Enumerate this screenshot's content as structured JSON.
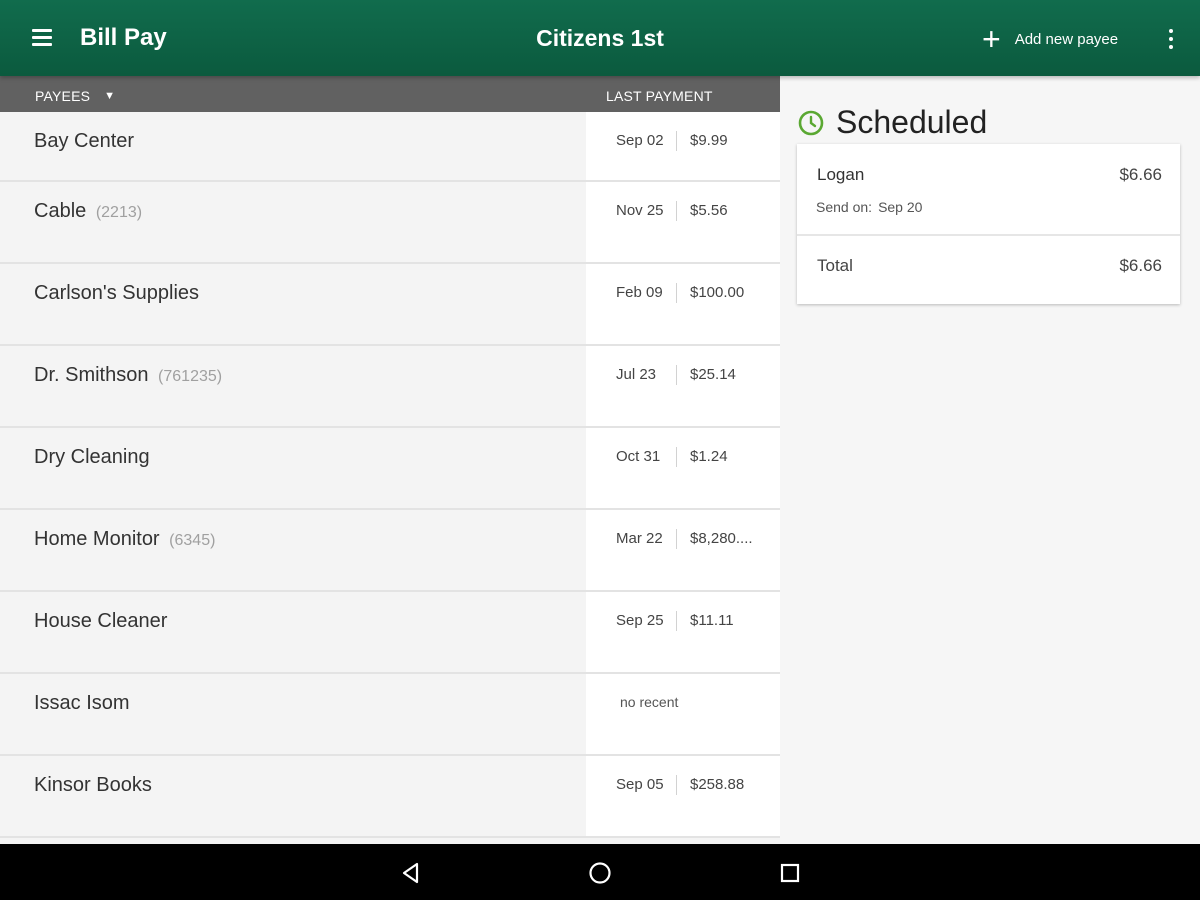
{
  "appbar": {
    "title": "Bill Pay",
    "center_title": "Citizens 1st",
    "add_payee_label": "Add new payee",
    "menu_icon": "hamburger-menu-icon",
    "overflow_icon": "more-vertical-icon",
    "add_icon": "plus-icon",
    "background_color": "#0f6547"
  },
  "list": {
    "header": {
      "payees_label": "PAYEES",
      "sort_icon": "caret-down-icon",
      "last_payment_label": "LAST PAYMENT"
    },
    "rows": [
      {
        "name": "Bay Center",
        "account": "",
        "date": "Sep 02",
        "amount": "$9.99"
      },
      {
        "name": "Cable",
        "account": "(2213)",
        "date": "Nov 25",
        "amount": "$5.56"
      },
      {
        "name": "Carlson's Supplies",
        "account": "",
        "date": "Feb 09",
        "amount": "$100.00"
      },
      {
        "name": "Dr. Smithson",
        "account": "(761235)",
        "date": "Jul 23",
        "amount": "$25.14"
      },
      {
        "name": "Dry Cleaning",
        "account": "",
        "date": "Oct 31",
        "amount": "$1.24"
      },
      {
        "name": "Home Monitor",
        "account": "(6345)",
        "date": "Mar 22",
        "amount": "$8,280...."
      },
      {
        "name": "House Cleaner",
        "account": "",
        "date": "Sep 25",
        "amount": "$11.11"
      },
      {
        "name": "Issac Isom",
        "account": "",
        "date": "",
        "amount": "",
        "no_recent": "no recent"
      },
      {
        "name": "Kinsor Books",
        "account": "",
        "date": "Sep 05",
        "amount": "$258.88"
      }
    ]
  },
  "scheduled": {
    "heading": "Scheduled",
    "icon": "clock-icon",
    "icon_color": "#5aa832",
    "item": {
      "payee": "Logan",
      "amount": "$6.66",
      "send_on_label": "Send on:",
      "send_on_date": "Sep 20"
    },
    "total_label": "Total",
    "total_amount": "$6.66"
  },
  "navbar": {
    "back_icon": "back-triangle-icon",
    "home_icon": "home-circle-icon",
    "recents_icon": "recents-square-icon"
  }
}
